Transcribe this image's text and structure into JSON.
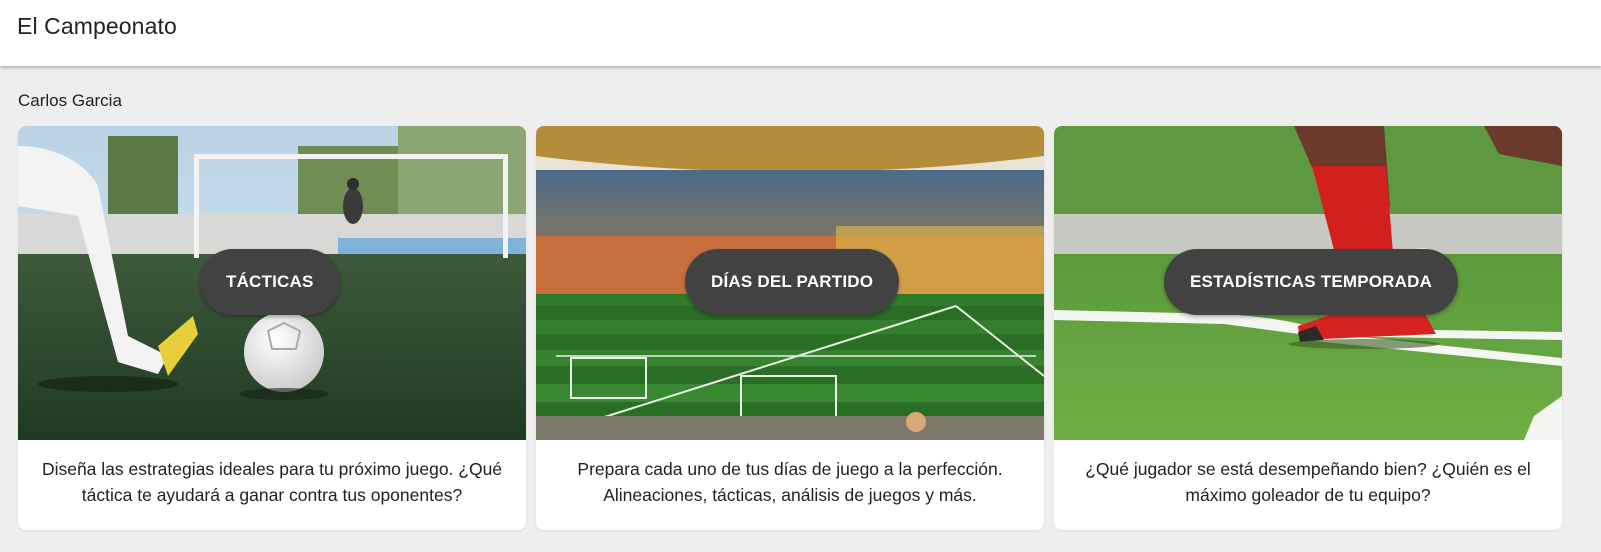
{
  "app": {
    "title": "El Campeonato"
  },
  "user": {
    "name": "Carlos Garcia"
  },
  "cards": [
    {
      "button_label": "TÁCTICAS",
      "description": "Diseña las estrategias ideales para tu próximo juego. ¿Qué táctica te ayudará a ganar contra tus oponentes?",
      "image": "soccer-kick-training-photo"
    },
    {
      "button_label": "DÍAS DEL PARTIDO",
      "description": "Prepara cada uno de tus días de juego a la perfección. Alineaciones, tácticas, análisis de juegos y más.",
      "image": "stadium-photo"
    },
    {
      "button_label": "ESTADÍSTICAS TEMPORADA",
      "description": "¿Qué jugador se está desempeñando bien? ¿Quién es el máximo goleador de tu equipo?",
      "image": "player-ball-corner-photo"
    }
  ],
  "colors": {
    "button_bg": "#424242",
    "button_text": "#ffffff",
    "page_bg": "#eeeeee",
    "card_bg": "#ffffff"
  }
}
